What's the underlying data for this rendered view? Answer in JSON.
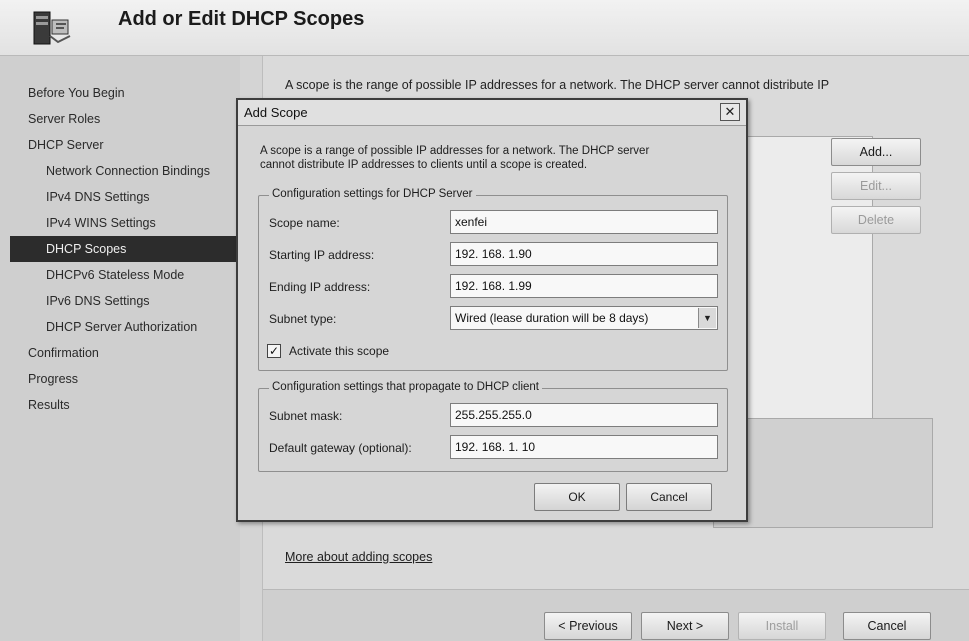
{
  "window": {
    "title": "Add or Edit DHCP Scopes",
    "icon": "dhcp-server-icon"
  },
  "sidebar": {
    "items": [
      {
        "label": "Before You Begin"
      },
      {
        "label": "Server Roles"
      },
      {
        "label": "DHCP Server"
      },
      {
        "label": "Network Connection Bindings"
      },
      {
        "label": "IPv4 DNS Settings"
      },
      {
        "label": "IPv4 WINS Settings"
      },
      {
        "label": "DHCP Scopes"
      },
      {
        "label": "DHCPv6 Stateless Mode"
      },
      {
        "label": "IPv6 DNS Settings"
      },
      {
        "label": "DHCP Server Authorization"
      },
      {
        "label": "Confirmation"
      },
      {
        "label": "Progress"
      },
      {
        "label": "Results"
      }
    ],
    "active": "DHCP Scopes"
  },
  "main": {
    "intro": "A scope is the range of possible IP addresses for a network. The DHCP server cannot distribute IP",
    "buttons": {
      "add": "Add...",
      "edit": "Edit...",
      "delete": "Delete"
    },
    "more_link": "More about adding scopes"
  },
  "footer": {
    "previous": "< Previous",
    "next": "Next >",
    "install": "Install",
    "cancel": "Cancel"
  },
  "dialog": {
    "title": "Add Scope",
    "close_glyph": "✕",
    "description_line1": "A scope is a range of possible IP addresses for a network. The DHCP server",
    "description_line2": "cannot distribute IP addresses to clients until a scope is created.",
    "server_group": {
      "legend": "Configuration settings for DHCP Server",
      "scope_name_label": "Scope name:",
      "scope_name_value": "xenfei",
      "start_ip_label": "Starting IP address:",
      "start_ip_value": "192. 168. 1.90",
      "end_ip_label": "Ending IP address:",
      "end_ip_value": "192. 168. 1.99",
      "subnet_type_label": "Subnet type:",
      "subnet_type_value": "Wired (lease duration will be 8 days)",
      "activate_label": "Activate this scope",
      "activate_checked": true,
      "check_glyph": "✓"
    },
    "client_group": {
      "legend": "Configuration settings that propagate to DHCP client",
      "subnet_mask_label": "Subnet mask:",
      "subnet_mask_value": "255.255.255.0",
      "gateway_label": "Default gateway (optional):",
      "gateway_value": "192. 168. 1. 10"
    },
    "ok": "OK",
    "cancel": "Cancel"
  },
  "colors": {
    "active_nav_bg": "#2c2c2c",
    "dialog_border": "#3d3d3d",
    "disabled_text": "#9a9a9a"
  }
}
